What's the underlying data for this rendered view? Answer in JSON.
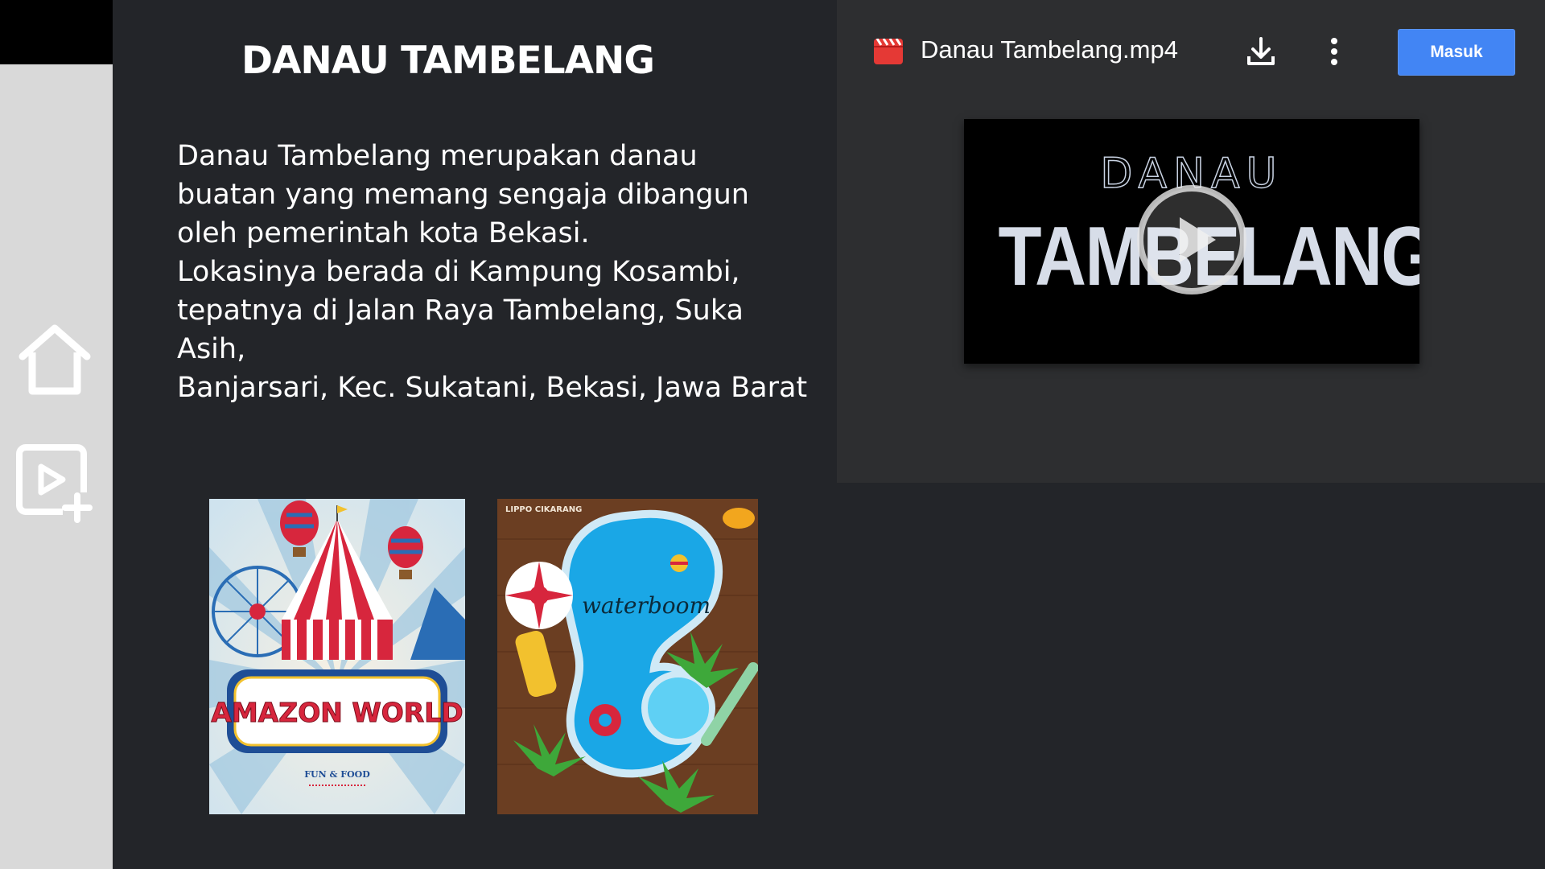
{
  "sidebar": {
    "icons": [
      "home-icon",
      "video-add-icon"
    ]
  },
  "main": {
    "title": "DANAU TAMBELANG",
    "description_lines": [
      "Danau Tambelang merupakan danau",
      "buatan yang memang sengaja dibangun",
      "oleh pemerintah kota Bekasi.",
      "Lokasinya berada di Kampung Kosambi,",
      "tepatnya di Jalan Raya Tambelang, Suka Asih,",
      "Banjarsari, Kec. Sukatani, Bekasi, Jawa Barat"
    ],
    "posters": [
      {
        "title": "AMAZON WORLD",
        "subtitle": "FUN & FOOD"
      },
      {
        "brand": "LIPPO CIKARANG",
        "title": "waterboom"
      }
    ]
  },
  "drive": {
    "file_name": "Danau Tambelang.mp4",
    "signin_label": "Masuk",
    "video": {
      "title_top": "DANAU",
      "title_main": "TAMBELANG"
    }
  },
  "colors": {
    "page_bg": "#232529",
    "sidebar_bg": "#d9d9d9",
    "drive_bg": "#2d2e30",
    "accent": "#4285f4",
    "file_icon": "#e53935"
  }
}
